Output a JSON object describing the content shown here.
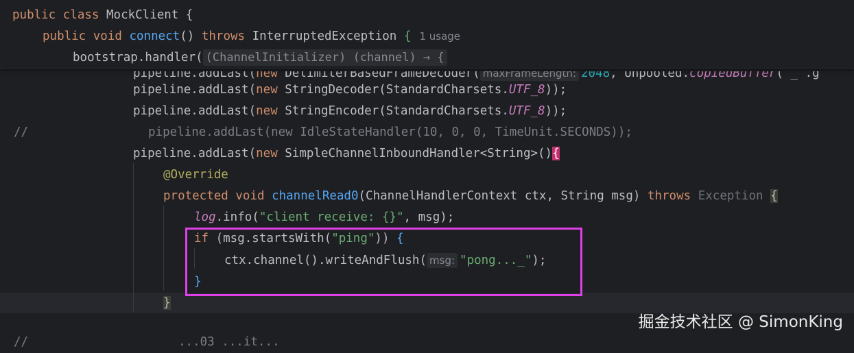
{
  "sticky": {
    "line1": {
      "kw1": "public",
      "kw2": "class",
      "name": "MockClient",
      "brace": "{"
    },
    "line2": {
      "kw1": "public",
      "kw2": "void",
      "fn": "connect",
      "parens": "()",
      "kw3": "throws",
      "exc": "InterruptedException",
      "brace": "{",
      "usage": "1 usage"
    },
    "line3": {
      "code": "bootstrap.handler(",
      "fold": "(ChannelInitializer) (channel) → {"
    }
  },
  "code": {
    "l0": {
      "pre": "pipeline.addLast(",
      "kw": "new",
      "cls": " DelimiterBasedFrameDecoder(",
      "hint": "maxFrameLength:",
      "num": "2048",
      "rest": ", Unpooled.",
      "it": "copiedBuffer",
      "tail": "(\"_\".g"
    },
    "l1": {
      "pre": "pipeline.addLast(",
      "kw": "new",
      "cls": " StringDecoder(StandardCharsets.",
      "it": "UTF_8",
      "tail": "));"
    },
    "l2": {
      "pre": "pipeline.addLast(",
      "kw": "new",
      "cls": " StringEncoder(StandardCharsets.",
      "it": "UTF_8",
      "tail": "));"
    },
    "l3": {
      "marker": "//",
      "text": "pipeline.addLast(new IdleStateHandler(10, 0, 0, TimeUnit.SECONDS));"
    },
    "l4": {
      "pre": "pipeline.addLast(",
      "kw": "new",
      "cls": " SimpleChannelInboundHandler<String>()",
      "brace": "{"
    },
    "l5": {
      "anno": "@Override"
    },
    "l6": {
      "kw1": "protected",
      "kw2": "void",
      "fn": "channelRead0",
      "params": "(ChannelHandlerContext ctx, String msg) ",
      "kw3": "throws",
      "exc": "Exception",
      "brace": "{"
    },
    "l7": {
      "log": "log",
      "rest": ".info(",
      "str": "\"client receive: {}\"",
      "tail": ", msg);"
    },
    "l8": {
      "kw": "if",
      "rest": " (msg.startsWith(",
      "str": "\"ping\"",
      "tail": ")) ",
      "brace": "{"
    },
    "l9": {
      "pre": "ctx.channel().writeAndFlush(",
      "hint": "msg:",
      "str": "\"pong..._\"",
      "tail": ");"
    },
    "l10": {
      "brace": "}"
    },
    "l11": {
      "brace": "}"
    },
    "l12": {
      "marker": "//",
      "text": "...03 ...it..."
    }
  },
  "watermark": "掘金技术社区 @ SimonKing",
  "colors": {
    "highlight_box": "#e040e8",
    "brace_match": "#c2306e"
  }
}
